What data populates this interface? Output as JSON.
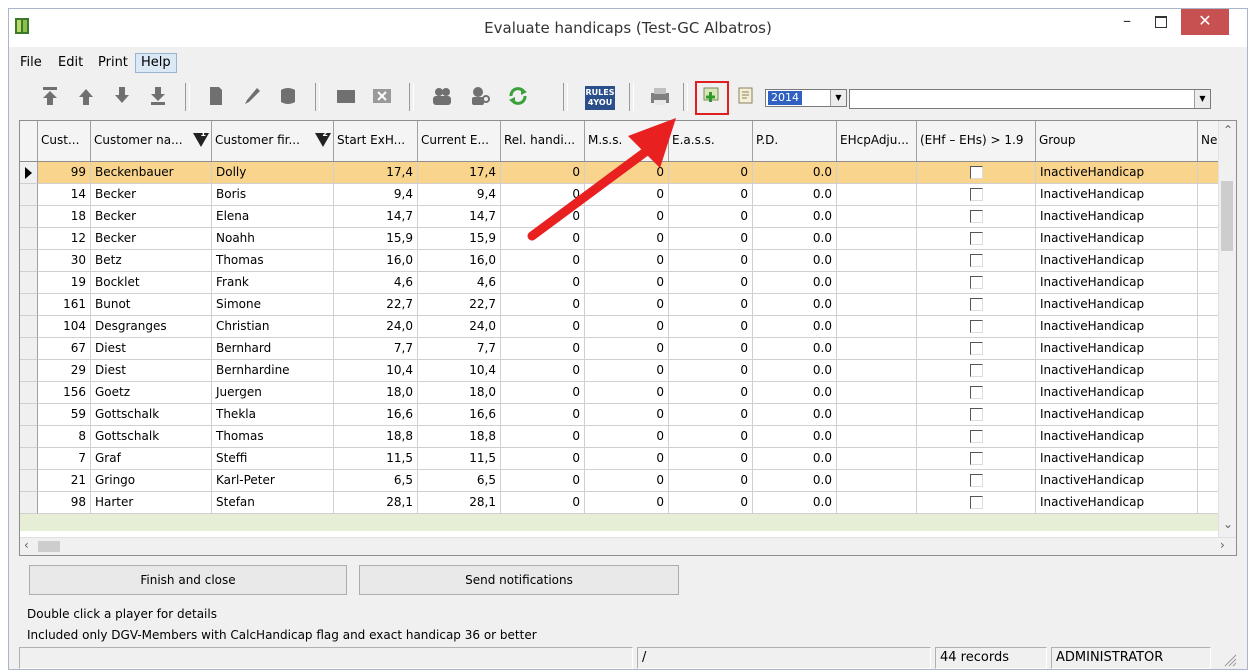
{
  "window": {
    "title": "Evaluate handicaps (Test-GC Albatros)",
    "min_glyph": "–",
    "close_glyph": "✕"
  },
  "menu": [
    "File",
    "Edit",
    "Print",
    "Help"
  ],
  "toolbar": {
    "rules_label_1": "RULES",
    "rules_label_2": "4YOU",
    "year_value": "2014",
    "combo_value": ""
  },
  "columns": [
    "Cust...",
    "Customer na...",
    "Customer fir...",
    "Start ExH...",
    "Current E...",
    "Rel. handi...",
    "M.s.s.",
    "E.a.s.s.",
    "P.D.",
    "EHcpAdju...",
    "(EHf – EHs) > 1.9",
    "Group",
    "Ne"
  ],
  "sort_badges": [
    "1",
    "2"
  ],
  "rows": [
    {
      "id": "99",
      "last": "Beckenbauer",
      "first": "Dolly",
      "start": "17,4",
      "current": "17,4",
      "rel": "0",
      "mss": "0",
      "eass": "0",
      "pd": "0.0",
      "group": "InactiveHandicap"
    },
    {
      "id": "14",
      "last": "Becker",
      "first": "Boris",
      "start": "9,4",
      "current": "9,4",
      "rel": "0",
      "mss": "0",
      "eass": "0",
      "pd": "0.0",
      "group": "InactiveHandicap"
    },
    {
      "id": "18",
      "last": "Becker",
      "first": "Elena",
      "start": "14,7",
      "current": "14,7",
      "rel": "0",
      "mss": "0",
      "eass": "0",
      "pd": "0.0",
      "group": "InactiveHandicap"
    },
    {
      "id": "12",
      "last": "Becker",
      "first": "Noahh",
      "start": "15,9",
      "current": "15,9",
      "rel": "0",
      "mss": "0",
      "eass": "0",
      "pd": "0.0",
      "group": "InactiveHandicap"
    },
    {
      "id": "30",
      "last": "Betz",
      "first": "Thomas",
      "start": "16,0",
      "current": "16,0",
      "rel": "0",
      "mss": "0",
      "eass": "0",
      "pd": "0.0",
      "group": "InactiveHandicap"
    },
    {
      "id": "19",
      "last": "Bocklet",
      "first": "Frank",
      "start": "4,6",
      "current": "4,6",
      "rel": "0",
      "mss": "0",
      "eass": "0",
      "pd": "0.0",
      "group": "InactiveHandicap"
    },
    {
      "id": "161",
      "last": "Bunot",
      "first": "Simone",
      "start": "22,7",
      "current": "22,7",
      "rel": "0",
      "mss": "0",
      "eass": "0",
      "pd": "0.0",
      "group": "InactiveHandicap"
    },
    {
      "id": "104",
      "last": "Desgranges",
      "first": "Christian",
      "start": "24,0",
      "current": "24,0",
      "rel": "0",
      "mss": "0",
      "eass": "0",
      "pd": "0.0",
      "group": "InactiveHandicap"
    },
    {
      "id": "67",
      "last": "Diest",
      "first": "Bernhard",
      "start": "7,7",
      "current": "7,7",
      "rel": "0",
      "mss": "0",
      "eass": "0",
      "pd": "0.0",
      "group": "InactiveHandicap"
    },
    {
      "id": "29",
      "last": "Diest",
      "first": "Bernhardine",
      "start": "10,4",
      "current": "10,4",
      "rel": "0",
      "mss": "0",
      "eass": "0",
      "pd": "0.0",
      "group": "InactiveHandicap"
    },
    {
      "id": "156",
      "last": "Goetz",
      "first": "Juergen",
      "start": "18,0",
      "current": "18,0",
      "rel": "0",
      "mss": "0",
      "eass": "0",
      "pd": "0.0",
      "group": "InactiveHandicap"
    },
    {
      "id": "59",
      "last": "Gottschalk",
      "first": "Thekla",
      "start": "16,6",
      "current": "16,6",
      "rel": "0",
      "mss": "0",
      "eass": "0",
      "pd": "0.0",
      "group": "InactiveHandicap"
    },
    {
      "id": "8",
      "last": "Gottschalk",
      "first": "Thomas",
      "start": "18,8",
      "current": "18,8",
      "rel": "0",
      "mss": "0",
      "eass": "0",
      "pd": "0.0",
      "group": "InactiveHandicap"
    },
    {
      "id": "7",
      "last": "Graf",
      "first": "Steffi",
      "start": "11,5",
      "current": "11,5",
      "rel": "0",
      "mss": "0",
      "eass": "0",
      "pd": "0.0",
      "group": "InactiveHandicap"
    },
    {
      "id": "21",
      "last": "Gringo",
      "first": "Karl-Peter",
      "start": "6,5",
      "current": "6,5",
      "rel": "0",
      "mss": "0",
      "eass": "0",
      "pd": "0.0",
      "group": "InactiveHandicap"
    },
    {
      "id": "98",
      "last": "Harter",
      "first": "Stefan",
      "start": "28,1",
      "current": "28,1",
      "rel": "0",
      "mss": "0",
      "eass": "0",
      "pd": "0.0",
      "group": "InactiveHandicap"
    }
  ],
  "buttons": {
    "finish": "Finish and close",
    "send": "Send notifications"
  },
  "info": {
    "line1": "Double click a player for details",
    "line2": "Included only DGV-Members with CalcHandicap flag and exact handicap 36 or better"
  },
  "status": {
    "p1": "",
    "p2": "/",
    "records": "44 records",
    "user": "ADMINISTRATOR"
  },
  "colors": {
    "selected_row": "#f8d48c",
    "highlight": "#e02020",
    "close_button": "#c75050"
  }
}
